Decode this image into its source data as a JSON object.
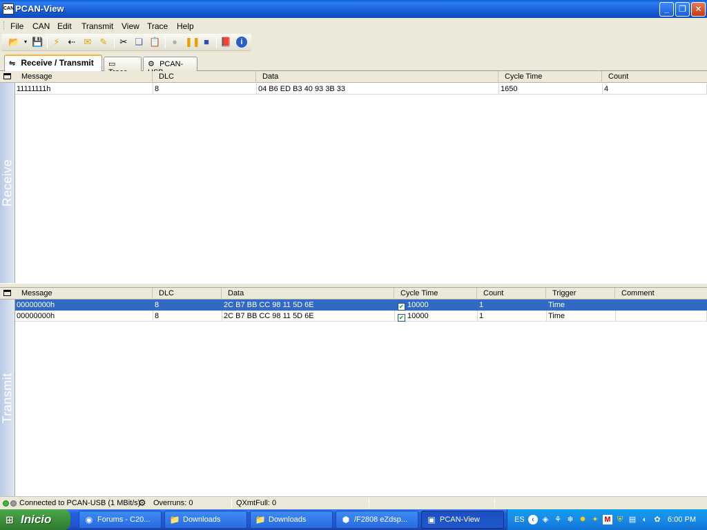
{
  "window": {
    "title": "PCAN-View",
    "app_icon_text": "CAN"
  },
  "menu": [
    "File",
    "CAN",
    "Edit",
    "Transmit",
    "View",
    "Trace",
    "Help"
  ],
  "toolbar_icons": [
    "open-icon",
    "save-icon",
    "connect-icon",
    "disconnect-icon",
    "new-message-icon",
    "edit-message-icon",
    "cut-icon",
    "copy-icon",
    "paste-icon",
    "record-icon",
    "pause-icon",
    "stop-icon",
    "help-book-icon",
    "info-icon"
  ],
  "tabs": [
    {
      "label": "Receive / Transmit",
      "icon": "receive-transmit-icon",
      "active": true
    },
    {
      "label": "Trace",
      "icon": "trace-icon",
      "active": false
    },
    {
      "label": "PCAN-USB",
      "icon": "usb-icon",
      "active": false
    }
  ],
  "receive": {
    "side_label": "Receive",
    "columns": [
      "Message",
      "DLC",
      "Data",
      "Cycle Time",
      "Count"
    ],
    "rows": [
      {
        "message": "11111111h",
        "dlc": "8",
        "data": "04 B6 ED B3 40 93 3B 33",
        "cycle_time": "1650",
        "count": "4"
      }
    ]
  },
  "transmit": {
    "side_label": "Transmit",
    "columns": [
      "Message",
      "DLC",
      "Data",
      "Cycle Time",
      "Count",
      "Trigger",
      "Comment"
    ],
    "rows": [
      {
        "message": "00000000h",
        "dlc": "8",
        "data": "2C B7 BB CC 98 11 5D 6E",
        "checked": true,
        "cycle_time": "10000",
        "count": "1",
        "trigger": "Time",
        "comment": "",
        "selected": true
      },
      {
        "message": "00000000h",
        "dlc": "8",
        "data": "2C B7 BB CC 98 11 5D 6E",
        "checked": true,
        "cycle_time": "10000",
        "count": "1",
        "trigger": "Time",
        "comment": "",
        "selected": false
      }
    ]
  },
  "status": {
    "connection": "Connected to PCAN-USB (1 MBit/s)",
    "overruns": "Overruns: 0",
    "qxmtfull": "QXmtFull: 0",
    "led_colors": [
      "#3cb83c",
      "#9a9a9a"
    ]
  },
  "taskbar": {
    "start_label": "Inicio",
    "tasks": [
      {
        "label": "Forums - C20...",
        "icon": "chrome-icon",
        "active": false
      },
      {
        "label": "Downloads",
        "icon": "folder-icon",
        "active": false
      },
      {
        "label": "Downloads",
        "icon": "folder-icon",
        "active": false
      },
      {
        "label": "/F2808 eZdsp...",
        "icon": "ccs-icon",
        "active": false
      },
      {
        "label": "PCAN-View",
        "icon": "pcan-icon",
        "active": true
      }
    ],
    "tray": {
      "language": "ES",
      "clock": "6:00 PM"
    }
  },
  "colors": {
    "selection": "#316ac5",
    "titlebar": "#0a5fd8",
    "side_panel": "#b9c9e4"
  }
}
